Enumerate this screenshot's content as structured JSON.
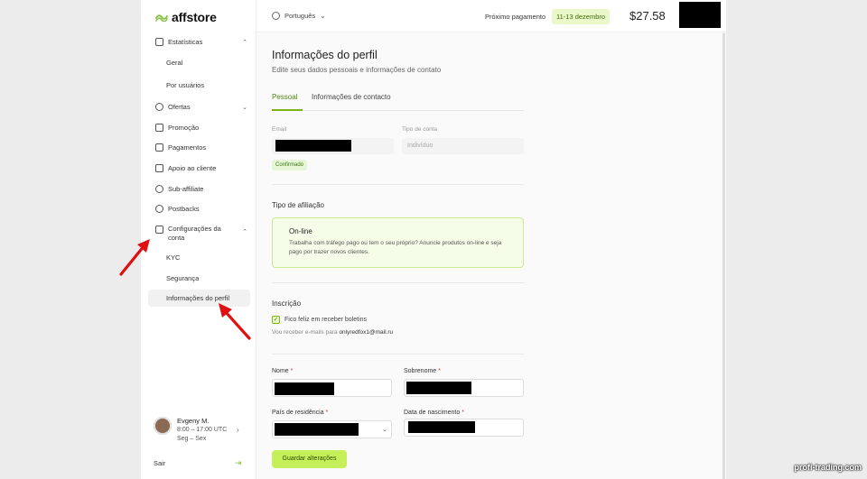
{
  "brand": {
    "name": "affstore",
    "accent": "#8bc34a"
  },
  "sidebar": {
    "items": [
      {
        "label": "Estatísticas",
        "icon": "chart-icon",
        "expanded": true
      },
      {
        "label": "Geral",
        "sub": true
      },
      {
        "label": "Por usuários",
        "sub": true
      },
      {
        "label": "Ofertas",
        "icon": "tag-icon",
        "expanded": false
      },
      {
        "label": "Promoção",
        "icon": "image-icon"
      },
      {
        "label": "Pagamentos",
        "icon": "wallet-icon"
      },
      {
        "label": "Apoio ao cliente",
        "icon": "book-icon"
      },
      {
        "label": "Sub-affiliate",
        "icon": "users-icon"
      },
      {
        "label": "Postbacks",
        "icon": "postback-icon"
      },
      {
        "label": "Configurações da conta",
        "icon": "account-icon",
        "expanded": true
      },
      {
        "label": "KYC",
        "sub": true
      },
      {
        "label": "Segurança",
        "sub": true
      },
      {
        "label": "Informações do perfil",
        "sub": true,
        "active": true
      }
    ],
    "profile": {
      "name": "Evgeny M.",
      "hours": "8:00 – 17:00 UTC",
      "days": "Seg – Sex"
    },
    "logout": "Sair"
  },
  "header": {
    "language": "Português",
    "next_payment_label": "Próximo pagamento",
    "next_payment_date": "11-13 dezembro",
    "balance": "$27.58"
  },
  "main": {
    "title": "Informações do perfil",
    "subtitle": "Edite seus dados pessoais e informações de contato",
    "tabs": [
      {
        "label": "Pessoal",
        "active": true
      },
      {
        "label": "Informações de contacto"
      }
    ],
    "email_label": "Email",
    "account_type_label": "Tipo de conta",
    "account_type_value": "Indivíduo",
    "confirmed_badge": "Confirmado",
    "affiliation_title": "Tipo de afiliação",
    "affiliation_card": {
      "title": "On-line",
      "description": "Trabalha com tráfego pago ou tem o seu próprio? Anuncie produtos on-line e seja pago por trazer novos clientes."
    },
    "subscription_title": "Inscrição",
    "newsletter_label": "Fico feliz em receber boletins",
    "newsletter_checked": true,
    "newsletter_info_prefix": "Vou receber e-mails para",
    "newsletter_email": "onlyredfox1@mail.ru",
    "first_name_label": "Nome",
    "last_name_label": "Sobrenome",
    "country_label": "País de residência",
    "birth_label": "Data de nascimento",
    "required_mark": "*",
    "save_button": "Guardar alterações"
  },
  "watermark": "profi-trading.com"
}
